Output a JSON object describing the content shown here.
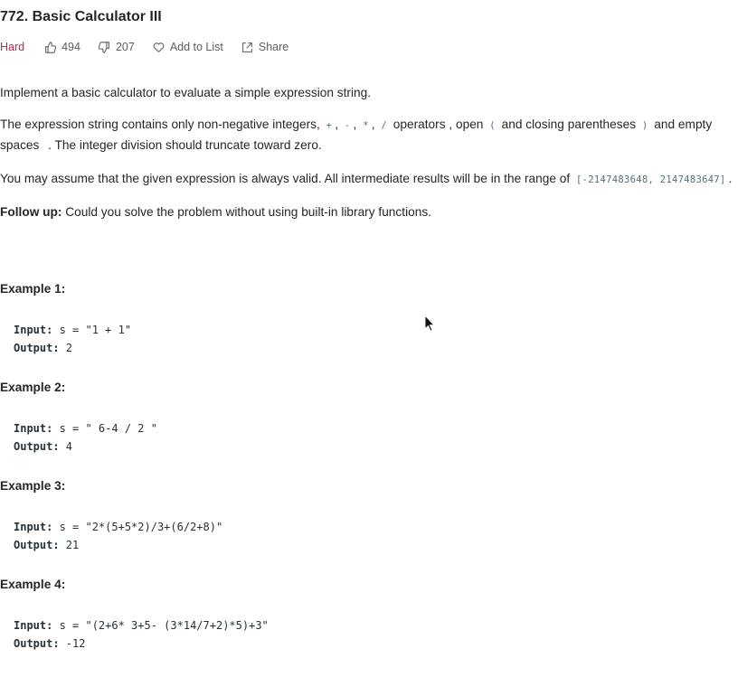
{
  "problem": {
    "title": "772. Basic Calculator III",
    "difficulty": "Hard",
    "likes": "494",
    "dislikes": "207",
    "add_to_list": "Add to List",
    "share": "Share"
  },
  "description": {
    "p1": "Implement a basic calculator to evaluate a simple expression string.",
    "p2_a": "The expression string contains only non-negative integers, ",
    "p2_plus": "+",
    "p2_minus": "-",
    "p2_times": "*",
    "p2_div": "/",
    "p2_b": " operators , open ",
    "p2_open": "(",
    "p2_c": " and closing parentheses ",
    "p2_close": ")",
    "p2_d": " and empty spaces ",
    "p2_space": " ",
    "p2_e": ". The integer division should truncate toward zero.",
    "p3_a": "You may assume that the given expression is always valid. All intermediate results will be in the range of ",
    "p3_range": "[-2147483648, 2147483647]",
    "p3_b": ".",
    "follow_label": "Follow up:",
    "follow_text": " Could you solve the problem without using built-in library functions."
  },
  "examples": [
    {
      "heading": "Example 1:",
      "input_label": "Input:",
      "input": " s = \"1 + 1\"",
      "output_label": "Output:",
      "output": " 2"
    },
    {
      "heading": "Example 2:",
      "input_label": "Input:",
      "input": " s = \" 6-4 / 2 \"",
      "output_label": "Output:",
      "output": " 4"
    },
    {
      "heading": "Example 3:",
      "input_label": "Input:",
      "input": " s = \"2*(5+5*2)/3+(6/2+8)\"",
      "output_label": "Output:",
      "output": " 21"
    },
    {
      "heading": "Example 4:",
      "input_label": "Input:",
      "input": " s = \"(2+6* 3+5- (3*14/7+2)*5)+3\"",
      "output_label": "Output:",
      "output": " -12"
    }
  ],
  "colors": {
    "hard": "#c0235a",
    "text": "#262626",
    "muted": "#5c5c5c"
  }
}
